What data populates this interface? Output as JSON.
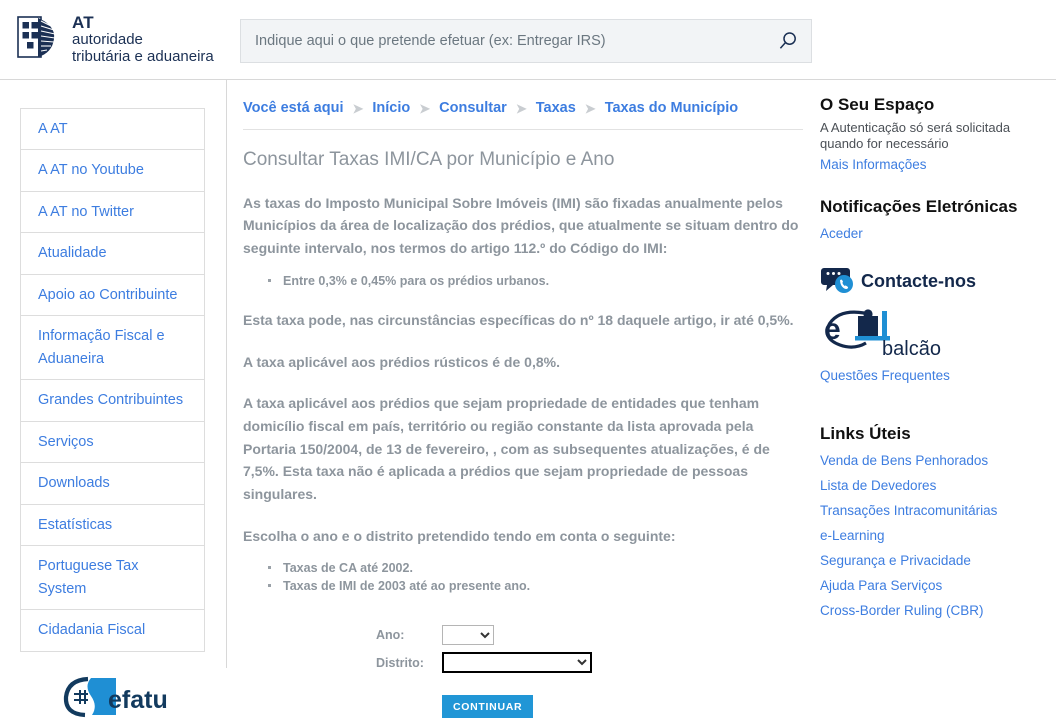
{
  "brand": {
    "line1": "AT",
    "line2": "autoridade",
    "line3": "tributária e aduaneira",
    "logo_icon": "at-coat-of-arms-logo",
    "navy": "#1b3054"
  },
  "search": {
    "placeholder": "Indique aqui o que pretende efetuar (ex: Entregar IRS)",
    "value": "",
    "icon": "search-icon"
  },
  "sidebar": {
    "items": [
      {
        "label": "A AT"
      },
      {
        "label": "A AT no Youtube"
      },
      {
        "label": "A AT no Twitter"
      },
      {
        "label": "Atualidade"
      },
      {
        "label": "Apoio ao Contribuinte"
      },
      {
        "label": "Informação Fiscal e Aduaneira"
      },
      {
        "label": "Grandes Contribuintes"
      },
      {
        "label": "Serviços"
      },
      {
        "label": "Downloads"
      },
      {
        "label": "Estatísticas"
      },
      {
        "label": "Portuguese Tax System"
      },
      {
        "label": "Cidadania Fiscal"
      }
    ],
    "efatura_logo": "efatura-logo",
    "efatura_label": "efatura",
    "link_color": "#3d7de0"
  },
  "breadcrumb": {
    "prefix": "Você está aqui",
    "separator": "➤",
    "items": [
      {
        "label": "Início"
      },
      {
        "label": "Consultar"
      },
      {
        "label": "Taxas"
      },
      {
        "label": "Taxas do Município"
      }
    ]
  },
  "main": {
    "title": "Consultar Taxas IMI/CA por Município e Ano",
    "paragraph_1": "As taxas do Imposto Municipal Sobre Imóveis (IMI) são fixadas anualmente pelos Municípios da área de localização dos prédios, que atualmente se situam dentro do seguinte intervalo, nos termos do artigo 112.º do Código do IMI:",
    "list_1": [
      "Entre 0,3% e 0,45% para os prédios urbanos."
    ],
    "paragraph_2": "Esta taxa pode, nas circunstâncias específicas do nº 18 daquele artigo, ir até 0,5%.",
    "paragraph_3": "A taxa aplicável aos prédios rústicos é de 0,8%.",
    "paragraph_4": "A taxa aplicável aos prédios que sejam propriedade de entidades que tenham domicílio fiscal em país, território ou região constante da lista aprovada pela Portaria 150/2004, de 13 de fevereiro, , com as subsequentes atualizações, é de 7,5%. Esta taxa não é aplicada a prédios que sejam propriedade de pessoas singulares.",
    "paragraph_5": "Escolha o ano e o distrito pretendido tendo em conta o seguinte:",
    "list_2": [
      "Taxas de CA até 2002.",
      "Taxas de IMI de 2003 até ao presente ano."
    ],
    "text_color": "#8d959d"
  },
  "form": {
    "ano_label": "Ano:",
    "ano_value": "",
    "ano_options": [
      ""
    ],
    "distrito_label": "Distrito:",
    "distrito_value": "",
    "distrito_options": [
      ""
    ],
    "submit_label": "CONTINUAR",
    "submit_color": "#2196d6",
    "distrito_focused": true
  },
  "rail": {
    "espaco_heading": "O Seu Espaço",
    "espaco_text": "A Autenticação só será solicitada quando for necessário",
    "espaco_link": "Mais Informações",
    "notif_heading": "Notificações Eletrónicas",
    "notif_link": "Aceder",
    "contact_icon": "chat-bubble-phone-icon",
    "contact_label": "Contacte-nos",
    "ebalcao_icon": "ebalcao-logo",
    "ebalcao_label": "balcão",
    "faq_link": "Questões Frequentes",
    "links_heading": "Links Úteis",
    "links": [
      {
        "label": "Venda de Bens Penhorados"
      },
      {
        "label": "Lista de Devedores"
      },
      {
        "label": "Transações Intracomunitárias"
      },
      {
        "label": "e-Learning"
      },
      {
        "label": "Segurança e Privacidade"
      },
      {
        "label": "Ajuda Para Serviços"
      },
      {
        "label": "Cross-Border Ruling (CBR)"
      }
    ]
  }
}
